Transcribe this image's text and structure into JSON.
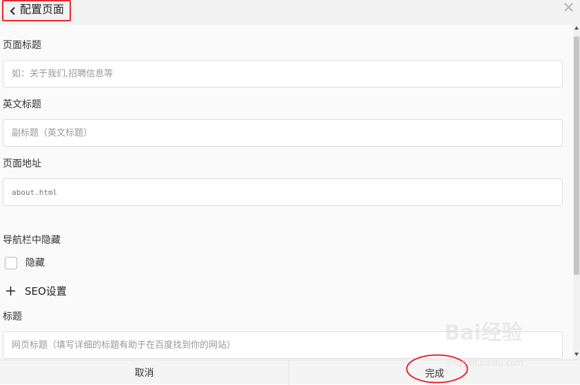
{
  "colors": {
    "annotation_red": "#e8272a",
    "header_background": "#f2f2f2",
    "content_background": "#fafafa",
    "input_border": "#dddddd",
    "placeholder_text": "#999999"
  },
  "header": {
    "back_icon": "chevron-left-icon",
    "title": "配置页面",
    "close_icon": "close-icon"
  },
  "form": {
    "page_title": {
      "label": "页面标题",
      "placeholder": "如：关于我们,招聘信息等"
    },
    "english_title": {
      "label": "英文标题",
      "placeholder": "副标题（英文标题）"
    },
    "page_address": {
      "label": "页面地址",
      "value": "about.html"
    },
    "nav_hidden": {
      "label": "导航栏中隐藏",
      "checkbox_label": "隐藏",
      "checked": false
    },
    "seo": {
      "icon": "plus-icon",
      "label": "SEO设置"
    },
    "seo_title": {
      "label": "标题",
      "placeholder": "网页标题（填写详细的标题有助于在百度找到你的网站）"
    }
  },
  "footer": {
    "cancel_label": "取消",
    "done_label": "完成"
  },
  "watermark": {
    "main": "Bai经验",
    "sub": "jingyan.baidu.com"
  }
}
